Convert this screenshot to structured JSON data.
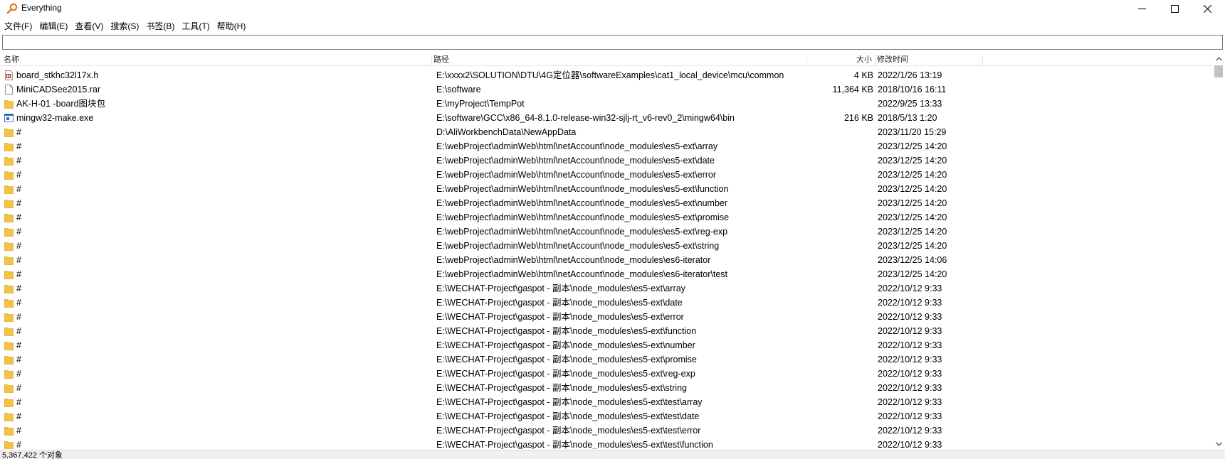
{
  "window": {
    "title": "Everything",
    "icon": "magnifier-icon"
  },
  "menu": [
    {
      "label": "文件(F)"
    },
    {
      "label": "编辑(E)"
    },
    {
      "label": "查看(V)"
    },
    {
      "label": "搜索(S)"
    },
    {
      "label": "书签(B)"
    },
    {
      "label": "工具(T)"
    },
    {
      "label": "帮助(H)"
    }
  ],
  "search": {
    "value": "",
    "placeholder": ""
  },
  "columns": {
    "name": "名称",
    "path": "路径",
    "size": "大小",
    "modified": "修改时间"
  },
  "rows": [
    {
      "icon": "h-file-icon",
      "name": "board_stkhc32l17x.h",
      "path": "E:\\xxxx2\\SOLUTION\\DTU\\4G定位器\\softwareExamples\\cat1_local_device\\mcu\\common",
      "size": "4 KB",
      "modified": "2022/1/26 13:19"
    },
    {
      "icon": "file-icon",
      "name": "MiniCADSee2015.rar",
      "path": "E:\\software",
      "size": "11,364 KB",
      "modified": "2018/10/16 16:11"
    },
    {
      "icon": "folder-icon",
      "name": "AK-H-01 -board图块包",
      "path": "E:\\myProject\\TempPot",
      "size": "",
      "modified": "2022/9/25 13:33"
    },
    {
      "icon": "exe-icon",
      "name": "mingw32-make.exe",
      "path": "E:\\software\\GCC\\x86_64-8.1.0-release-win32-sjlj-rt_v6-rev0_2\\mingw64\\bin",
      "size": "216 KB",
      "modified": "2018/5/13 1:20"
    },
    {
      "icon": "folder-icon",
      "name": "#",
      "path": "D:\\AliWorkbenchData\\NewAppData",
      "size": "",
      "modified": "2023/11/20 15:29"
    },
    {
      "icon": "folder-icon",
      "name": "#",
      "path": "E:\\webProject\\adminWeb\\html\\netAccount\\node_modules\\es5-ext\\array",
      "size": "",
      "modified": "2023/12/25 14:20"
    },
    {
      "icon": "folder-icon",
      "name": "#",
      "path": "E:\\webProject\\adminWeb\\html\\netAccount\\node_modules\\es5-ext\\date",
      "size": "",
      "modified": "2023/12/25 14:20"
    },
    {
      "icon": "folder-icon",
      "name": "#",
      "path": "E:\\webProject\\adminWeb\\html\\netAccount\\node_modules\\es5-ext\\error",
      "size": "",
      "modified": "2023/12/25 14:20"
    },
    {
      "icon": "folder-icon",
      "name": "#",
      "path": "E:\\webProject\\adminWeb\\html\\netAccount\\node_modules\\es5-ext\\function",
      "size": "",
      "modified": "2023/12/25 14:20"
    },
    {
      "icon": "folder-icon",
      "name": "#",
      "path": "E:\\webProject\\adminWeb\\html\\netAccount\\node_modules\\es5-ext\\number",
      "size": "",
      "modified": "2023/12/25 14:20"
    },
    {
      "icon": "folder-icon",
      "name": "#",
      "path": "E:\\webProject\\adminWeb\\html\\netAccount\\node_modules\\es5-ext\\promise",
      "size": "",
      "modified": "2023/12/25 14:20"
    },
    {
      "icon": "folder-icon",
      "name": "#",
      "path": "E:\\webProject\\adminWeb\\html\\netAccount\\node_modules\\es5-ext\\reg-exp",
      "size": "",
      "modified": "2023/12/25 14:20"
    },
    {
      "icon": "folder-icon",
      "name": "#",
      "path": "E:\\webProject\\adminWeb\\html\\netAccount\\node_modules\\es5-ext\\string",
      "size": "",
      "modified": "2023/12/25 14:20"
    },
    {
      "icon": "folder-icon",
      "name": "#",
      "path": "E:\\webProject\\adminWeb\\html\\netAccount\\node_modules\\es6-iterator",
      "size": "",
      "modified": "2023/12/25 14:06"
    },
    {
      "icon": "folder-icon",
      "name": "#",
      "path": "E:\\webProject\\adminWeb\\html\\netAccount\\node_modules\\es6-iterator\\test",
      "size": "",
      "modified": "2023/12/25 14:20"
    },
    {
      "icon": "folder-icon",
      "name": "#",
      "path": "E:\\WECHAT-Project\\gaspot - 副本\\node_modules\\es5-ext\\array",
      "size": "",
      "modified": "2022/10/12 9:33"
    },
    {
      "icon": "folder-icon",
      "name": "#",
      "path": "E:\\WECHAT-Project\\gaspot - 副本\\node_modules\\es5-ext\\date",
      "size": "",
      "modified": "2022/10/12 9:33"
    },
    {
      "icon": "folder-icon",
      "name": "#",
      "path": "E:\\WECHAT-Project\\gaspot - 副本\\node_modules\\es5-ext\\error",
      "size": "",
      "modified": "2022/10/12 9:33"
    },
    {
      "icon": "folder-icon",
      "name": "#",
      "path": "E:\\WECHAT-Project\\gaspot - 副本\\node_modules\\es5-ext\\function",
      "size": "",
      "modified": "2022/10/12 9:33"
    },
    {
      "icon": "folder-icon",
      "name": "#",
      "path": "E:\\WECHAT-Project\\gaspot - 副本\\node_modules\\es5-ext\\number",
      "size": "",
      "modified": "2022/10/12 9:33"
    },
    {
      "icon": "folder-icon",
      "name": "#",
      "path": "E:\\WECHAT-Project\\gaspot - 副本\\node_modules\\es5-ext\\promise",
      "size": "",
      "modified": "2022/10/12 9:33"
    },
    {
      "icon": "folder-icon",
      "name": "#",
      "path": "E:\\WECHAT-Project\\gaspot - 副本\\node_modules\\es5-ext\\reg-exp",
      "size": "",
      "modified": "2022/10/12 9:33"
    },
    {
      "icon": "folder-icon",
      "name": "#",
      "path": "E:\\WECHAT-Project\\gaspot - 副本\\node_modules\\es5-ext\\string",
      "size": "",
      "modified": "2022/10/12 9:33"
    },
    {
      "icon": "folder-icon",
      "name": "#",
      "path": "E:\\WECHAT-Project\\gaspot - 副本\\node_modules\\es5-ext\\test\\array",
      "size": "",
      "modified": "2022/10/12 9:33"
    },
    {
      "icon": "folder-icon",
      "name": "#",
      "path": "E:\\WECHAT-Project\\gaspot - 副本\\node_modules\\es5-ext\\test\\date",
      "size": "",
      "modified": "2022/10/12 9:33"
    },
    {
      "icon": "folder-icon",
      "name": "#",
      "path": "E:\\WECHAT-Project\\gaspot - 副本\\node_modules\\es5-ext\\test\\error",
      "size": "",
      "modified": "2022/10/12 9:33"
    },
    {
      "icon": "folder-icon",
      "name": "#",
      "path": "E:\\WECHAT-Project\\gaspot - 副本\\node_modules\\es5-ext\\test\\function",
      "size": "",
      "modified": "2022/10/12 9:33"
    }
  ],
  "status": {
    "text": "5,367,422 个对象"
  },
  "colors": {
    "folder": "#f5c242",
    "folder_dark": "#dca92a",
    "h_file": "#c0392b",
    "exe": "#2d6cc0"
  }
}
